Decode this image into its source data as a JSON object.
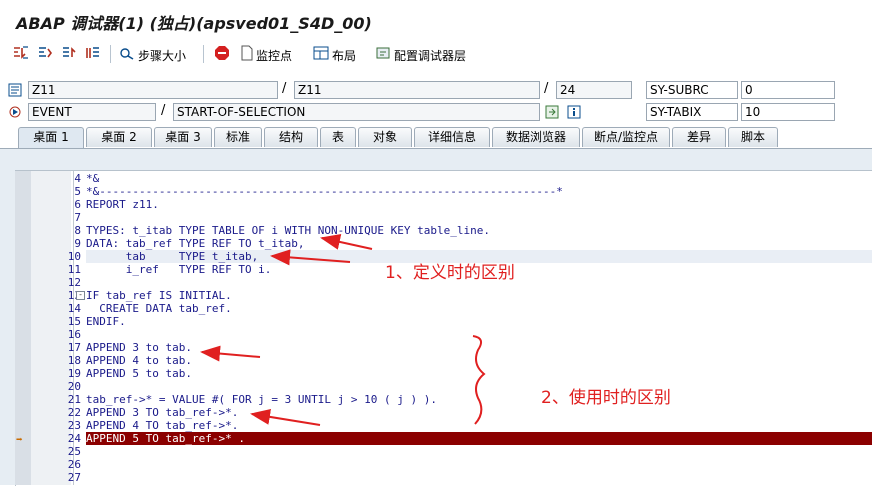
{
  "window": {
    "title": "ABAP 调试器(1) (独占)(apsved01_S4D_00)"
  },
  "toolbar": {
    "step_size_label": "步骤大小",
    "watchpoint_label": "监控点",
    "layout_label": "布局",
    "configure_label": "配置调试器层"
  },
  "fields": {
    "program": "Z11",
    "include": "Z11",
    "line": "24",
    "sy_subrc_label": "SY-SUBRC",
    "sy_subrc_value": "0",
    "event_type": "EVENT",
    "event_name": "START-OF-SELECTION",
    "sy_tabix_label": "SY-TABIX",
    "sy_tabix_value": "10"
  },
  "tabs": [
    {
      "label": "桌面 1",
      "active": true
    },
    {
      "label": "桌面 2",
      "active": false
    },
    {
      "label": "桌面 3",
      "active": false
    },
    {
      "label": "标准",
      "active": false
    },
    {
      "label": "结构",
      "active": false
    },
    {
      "label": "表",
      "active": false
    },
    {
      "label": "对象",
      "active": false
    },
    {
      "label": "详细信息",
      "active": false
    },
    {
      "label": "数据浏览器",
      "active": false
    },
    {
      "label": "断点/监控点",
      "active": false
    },
    {
      "label": "差异",
      "active": false
    },
    {
      "label": "脚本",
      "active": false
    }
  ],
  "code_lines": [
    {
      "num": "4",
      "text": "*&"
    },
    {
      "num": "5",
      "text": "*&---------------------------------------------------------------------*"
    },
    {
      "num": "6",
      "text": "REPORT z11."
    },
    {
      "num": "7",
      "text": ""
    },
    {
      "num": "8",
      "text": "TYPES: t_itab TYPE TABLE OF i WITH NON-UNIQUE KEY table_line."
    },
    {
      "num": "9",
      "text": "DATA: tab_ref TYPE REF TO t_itab,"
    },
    {
      "num": "10",
      "text": "      tab     TYPE t_itab,"
    },
    {
      "num": "11",
      "text": "      i_ref   TYPE REF TO i."
    },
    {
      "num": "12",
      "text": ""
    },
    {
      "num": "13",
      "text": "IF tab_ref IS INITIAL."
    },
    {
      "num": "14",
      "text": "  CREATE DATA tab_ref."
    },
    {
      "num": "15",
      "text": "ENDIF."
    },
    {
      "num": "16",
      "text": ""
    },
    {
      "num": "17",
      "text": "APPEND 3 to tab."
    },
    {
      "num": "18",
      "text": "APPEND 4 to tab."
    },
    {
      "num": "19",
      "text": "APPEND 5 to tab."
    },
    {
      "num": "20",
      "text": ""
    },
    {
      "num": "21",
      "text": "tab_ref->* = VALUE #( FOR j = 3 UNTIL j > 10 ( j ) )."
    },
    {
      "num": "22",
      "text": "APPEND 3 TO tab_ref->*."
    },
    {
      "num": "23",
      "text": "APPEND 4 TO tab_ref->*."
    },
    {
      "num": "24",
      "text": "APPEND 5 TO tab_ref->* ."
    },
    {
      "num": "25",
      "text": ""
    },
    {
      "num": "26",
      "text": ""
    },
    {
      "num": "27",
      "text": ""
    }
  ],
  "annotations": {
    "definition_diff": "1、定义时的区别",
    "usage_diff": "2、使用时的区别"
  },
  "colors": {
    "current_line": "#8b0000",
    "annotation": "#e02020",
    "code_text": "#1a1a8a"
  }
}
